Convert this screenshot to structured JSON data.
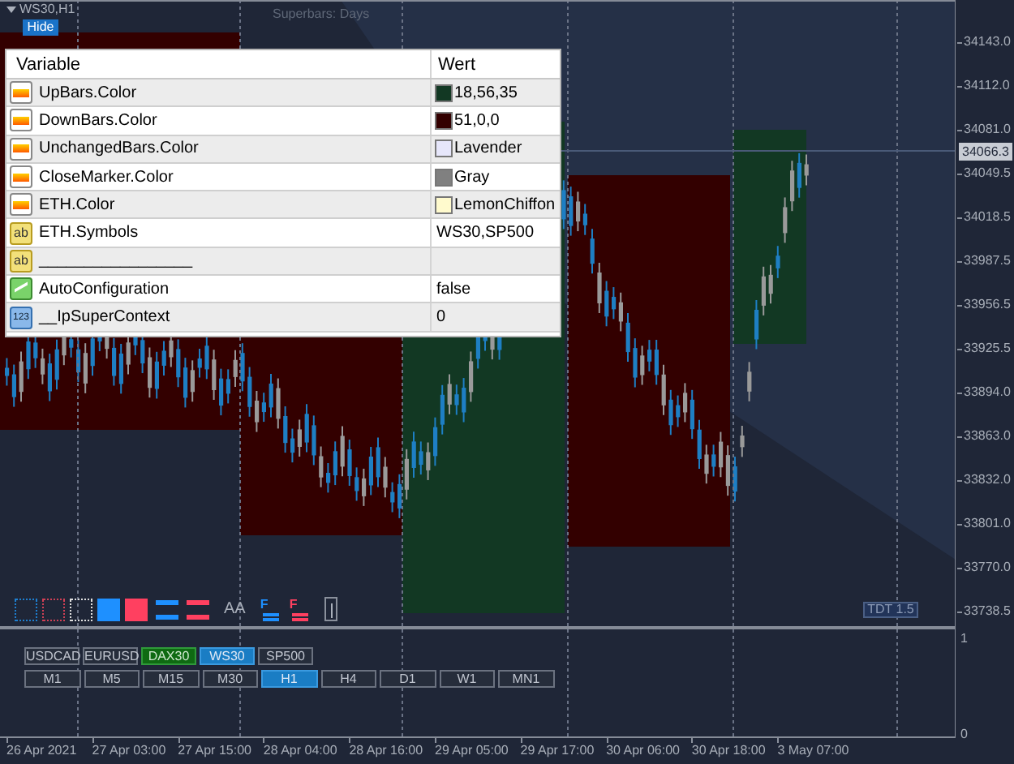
{
  "chart": {
    "symbol_label": "WS30,H1",
    "hide_button": "Hide",
    "indicator_title": "Superbars: Days",
    "badge": "TDT 1.5"
  },
  "properties_table": {
    "columns": [
      "Variable",
      "Wert"
    ],
    "rows": [
      {
        "kind": "color",
        "name": "UpBars.Color",
        "value": "18,56,35",
        "color": "#123823"
      },
      {
        "kind": "color",
        "name": "DownBars.Color",
        "value": "51,0,0",
        "color": "#330000"
      },
      {
        "kind": "color",
        "name": "UnchangedBars.Color",
        "value": "Lavender",
        "color": "#e6e6fa"
      },
      {
        "kind": "color",
        "name": "CloseMarker.Color",
        "value": "Gray",
        "color": "#808080"
      },
      {
        "kind": "color",
        "name": "ETH.Color",
        "value": "LemonChiffon",
        "color": "#fffacd"
      },
      {
        "kind": "string",
        "icon_text": "ab",
        "name": "ETH.Symbols",
        "value": "WS30,SP500"
      },
      {
        "kind": "string",
        "icon_text": "ab",
        "name": "_________________"
      },
      {
        "kind": "bool",
        "name": "AutoConfiguration",
        "value": "false"
      },
      {
        "kind": "int",
        "icon_text": "123",
        "name": "__IpSuperContext",
        "value": "0"
      }
    ]
  },
  "toolbar": [
    {
      "kind": "dotted-square",
      "color": "#1e7fd0"
    },
    {
      "kind": "dotted-square",
      "color": "#d04055"
    },
    {
      "kind": "dotted-square",
      "color": "#e0e0e0"
    },
    {
      "kind": "filled-square",
      "color": "#1e90ff"
    },
    {
      "kind": "filled-square",
      "color": "#ff4060"
    },
    {
      "kind": "double-line",
      "color": "#1e90ff"
    },
    {
      "kind": "double-line",
      "color": "#ff4060"
    },
    {
      "kind": "text",
      "label": "AA"
    },
    {
      "kind": "f-arrow",
      "label": "F",
      "color": "#1e90ff"
    },
    {
      "kind": "f-arrow",
      "label": "F",
      "color": "#ff4060"
    },
    {
      "kind": "arrow-box"
    }
  ],
  "symbol_buttons": [
    {
      "label": "USDCAD",
      "selected": false,
      "open": false
    },
    {
      "label": "EURUSD",
      "selected": false,
      "open": false
    },
    {
      "label": "DAX30",
      "selected": false,
      "open": true
    },
    {
      "label": "WS30",
      "selected": true,
      "open": false
    },
    {
      "label": "SP500",
      "selected": false,
      "open": false
    }
  ],
  "timeframe_buttons": [
    {
      "label": "M1",
      "selected": false
    },
    {
      "label": "M5",
      "selected": false
    },
    {
      "label": "M15",
      "selected": false
    },
    {
      "label": "M30",
      "selected": false
    },
    {
      "label": "H1",
      "selected": true
    },
    {
      "label": "H4",
      "selected": false
    },
    {
      "label": "D1",
      "selected": false
    },
    {
      "label": "W1",
      "selected": false
    },
    {
      "label": "MN1",
      "selected": false
    }
  ],
  "price_axis": {
    "labels": [
      "34143.0",
      "34112.0",
      "34081.0",
      "34049.5",
      "34018.5",
      "33987.5",
      "33956.5",
      "33925.5",
      "33894.0",
      "33863.0",
      "33832.0",
      "33801.0",
      "33770.0",
      "33738.5"
    ],
    "current_price": "34066.3"
  },
  "subwindow_axis": {
    "labels": [
      "1",
      "0"
    ]
  },
  "time_axis": {
    "labels": [
      "26 Apr 2021",
      "27 Apr 03:00",
      "27 Apr 15:00",
      "28 Apr 04:00",
      "28 Apr 16:00",
      "29 Apr 05:00",
      "29 Apr 17:00",
      "30 Apr 06:00",
      "30 Apr 18:00",
      "3 May 07:00"
    ]
  }
}
